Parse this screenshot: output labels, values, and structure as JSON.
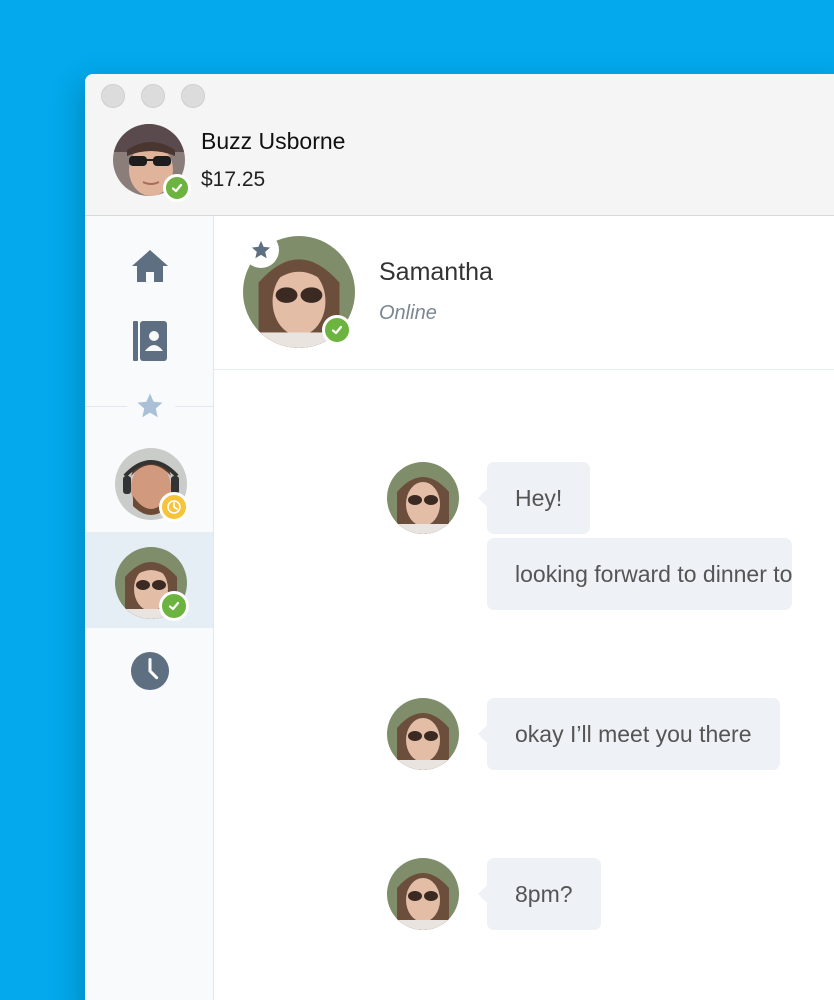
{
  "user": {
    "name": "Buzz Usborne",
    "balance": "$17.25",
    "status": "online"
  },
  "sidebar": {
    "items": [
      {
        "icon": "home-icon"
      },
      {
        "icon": "contacts-icon"
      },
      {
        "icon": "favorites-star-icon"
      },
      {
        "icon": "contact-avatar",
        "status": "away"
      },
      {
        "icon": "contact-avatar",
        "status": "online",
        "active": true
      },
      {
        "icon": "history-clock-icon"
      }
    ]
  },
  "chat": {
    "contact_name": "Samantha",
    "contact_status": "Online",
    "messages": [
      {
        "text": "Hey!"
      },
      {
        "text": "looking forward to dinner to"
      },
      {
        "text": "okay I’ll meet you there"
      },
      {
        "text": "8pm?"
      }
    ]
  },
  "colors": {
    "background": "#03a9ec",
    "online": "#6cb33f",
    "away": "#f6c33a",
    "icon": "#5f6f82",
    "bubble": "#eef1f5"
  }
}
